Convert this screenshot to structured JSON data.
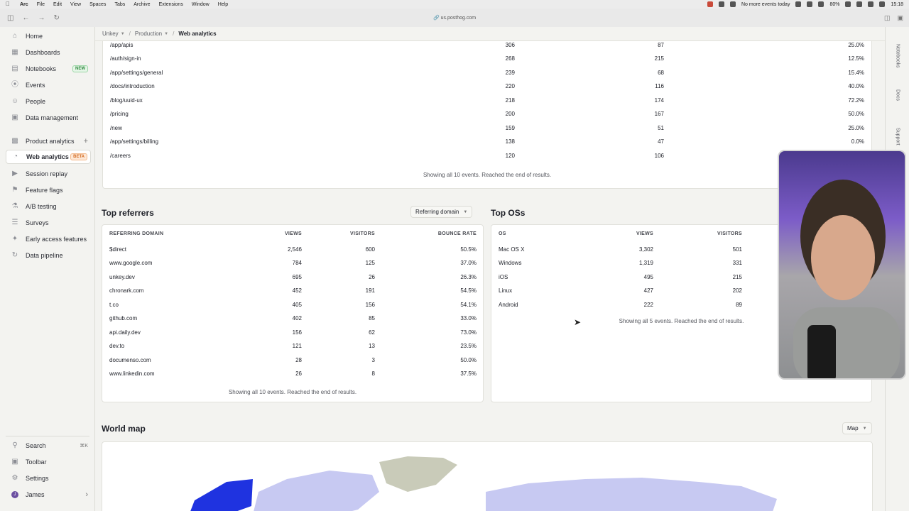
{
  "menubar": {
    "app": "Arc",
    "items": [
      "File",
      "Edit",
      "View",
      "Spaces",
      "Tabs",
      "Archive",
      "Extensions",
      "Window",
      "Help"
    ],
    "calendar": "No more events today",
    "battery": "80%",
    "time": "15:18"
  },
  "browser": {
    "url": "us.posthog.com"
  },
  "sidebar": {
    "items": [
      {
        "label": "Home",
        "icon": "home-icon"
      },
      {
        "label": "Dashboards",
        "icon": "dashboard-icon"
      },
      {
        "label": "Notebooks",
        "icon": "notebook-icon",
        "badge": "NEW"
      },
      {
        "label": "Events",
        "icon": "events-icon"
      },
      {
        "label": "People",
        "icon": "people-icon"
      },
      {
        "label": "Data management",
        "icon": "database-icon"
      },
      {
        "label": "Product analytics",
        "icon": "chart-icon"
      },
      {
        "label": "Web analytics",
        "icon": "web-analytics-icon",
        "badge": "BETA"
      },
      {
        "label": "Session replay",
        "icon": "replay-icon"
      },
      {
        "label": "Feature flags",
        "icon": "flag-icon"
      },
      {
        "label": "A/B testing",
        "icon": "flask-icon"
      },
      {
        "label": "Surveys",
        "icon": "survey-icon"
      },
      {
        "label": "Early access features",
        "icon": "rocket-icon"
      },
      {
        "label": "Data pipeline",
        "icon": "pipeline-icon"
      }
    ],
    "bottom": [
      {
        "label": "Search",
        "icon": "search-icon",
        "kbd": "⌘K"
      },
      {
        "label": "Toolbar",
        "icon": "toolbar-icon"
      },
      {
        "label": "Settings",
        "icon": "gear-icon"
      },
      {
        "label": "James",
        "icon": "avatar",
        "initial": "J"
      }
    ]
  },
  "breadcrumb": [
    "Unkey",
    "Production",
    "Web analytics"
  ],
  "paths": {
    "rows": [
      {
        "path": "/app/apis",
        "views": "306",
        "visitors": "87",
        "bounce": "25.0%"
      },
      {
        "path": "/auth/sign-in",
        "views": "268",
        "visitors": "215",
        "bounce": "12.5%"
      },
      {
        "path": "/app/settings/general",
        "views": "239",
        "visitors": "68",
        "bounce": "15.4%"
      },
      {
        "path": "/docs/introduction",
        "views": "220",
        "visitors": "116",
        "bounce": "40.0%"
      },
      {
        "path": "/blog/uuid-ux",
        "views": "218",
        "visitors": "174",
        "bounce": "72.2%"
      },
      {
        "path": "/pricing",
        "views": "200",
        "visitors": "167",
        "bounce": "50.0%"
      },
      {
        "path": "/new",
        "views": "159",
        "visitors": "51",
        "bounce": "25.0%"
      },
      {
        "path": "/app/settings/billing",
        "views": "138",
        "visitors": "47",
        "bounce": "0.0%"
      },
      {
        "path": "/careers",
        "views": "120",
        "visitors": "106",
        "bounce": ""
      }
    ],
    "footer": "Showing all 10 events. Reached the end of results."
  },
  "referrers": {
    "title": "Top referrers",
    "dropdown": "Referring domain",
    "headers": [
      "REFERRING DOMAIN",
      "VIEWS",
      "VISITORS",
      "BOUNCE RATE"
    ],
    "rows": [
      {
        "domain": "$direct",
        "views": "2,546",
        "visitors": "600",
        "bounce": "50.5%"
      },
      {
        "domain": "www.google.com",
        "views": "784",
        "visitors": "125",
        "bounce": "37.0%"
      },
      {
        "domain": "unkey.dev",
        "views": "695",
        "visitors": "26",
        "bounce": "26.3%"
      },
      {
        "domain": "chronark.com",
        "views": "452",
        "visitors": "191",
        "bounce": "54.5%"
      },
      {
        "domain": "t.co",
        "views": "405",
        "visitors": "156",
        "bounce": "54.1%"
      },
      {
        "domain": "github.com",
        "views": "402",
        "visitors": "85",
        "bounce": "33.0%"
      },
      {
        "domain": "api.daily.dev",
        "views": "156",
        "visitors": "62",
        "bounce": "73.0%"
      },
      {
        "domain": "dev.to",
        "views": "121",
        "visitors": "13",
        "bounce": "23.5%"
      },
      {
        "domain": "documenso.com",
        "views": "28",
        "visitors": "3",
        "bounce": "50.0%"
      },
      {
        "domain": "www.linkedin.com",
        "views": "26",
        "visitors": "8",
        "bounce": "37.5%"
      }
    ],
    "footer": "Showing all 10 events. Reached the end of results."
  },
  "os": {
    "title": "Top OSs",
    "headers": [
      "OS",
      "VIEWS",
      "VISITORS"
    ],
    "rows": [
      {
        "os": "Mac OS X",
        "views": "3,302",
        "visitors": "501"
      },
      {
        "os": "Windows",
        "views": "1,319",
        "visitors": "331"
      },
      {
        "os": "iOS",
        "views": "495",
        "visitors": "215"
      },
      {
        "os": "Linux",
        "views": "427",
        "visitors": "202"
      },
      {
        "os": "Android",
        "views": "222",
        "visitors": "89"
      }
    ],
    "footer": "Showing all 5 events. Reached the end of results."
  },
  "worldmap": {
    "title": "World map",
    "dropdown": "Map"
  },
  "rightstrip": [
    "Notebooks",
    "Docs",
    "Support"
  ],
  "colors": {
    "map_highlight": "#1f33e0",
    "map_base": "#c7c9f2",
    "map_land": "#c9cbb9"
  }
}
